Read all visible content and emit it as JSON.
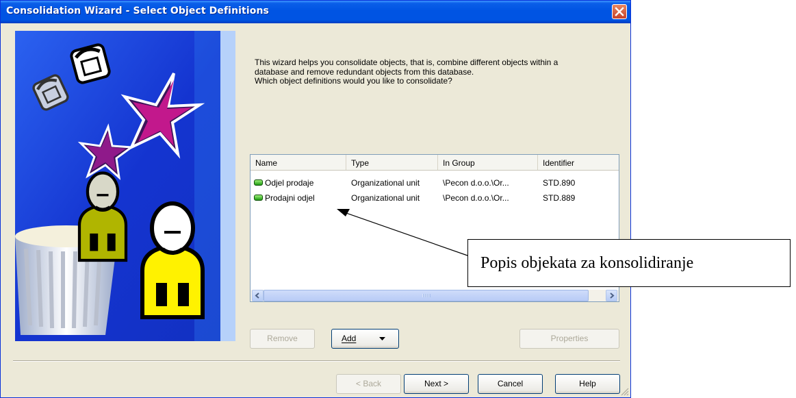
{
  "window": {
    "title": "Consolidation Wizard - Select Object Definitions",
    "close_icon": "close-icon"
  },
  "intro": {
    "line1": "This wizard helps you consolidate objects, that is, combine different objects within a",
    "line2": "database and remove redundant objects from this database.",
    "line3": "Which object definitions would you like to consolidate?"
  },
  "list": {
    "columns": [
      "Name",
      "Type",
      "In Group",
      "Identifier"
    ],
    "rows": [
      {
        "name": "Odjel prodaje",
        "type": "Organizational unit",
        "group": "\\Pecon d.o.o.\\Or...",
        "identifier": "STD.890",
        "icon": "organizational-unit-icon"
      },
      {
        "name": "Prodajni odjel",
        "type": "Organizational unit",
        "group": "\\Pecon d.o.o.\\Or...",
        "identifier": "STD.889",
        "icon": "organizational-unit-icon"
      }
    ]
  },
  "buttons": {
    "remove": "Remove",
    "add": "Add",
    "properties": "Properties",
    "back": "< Back",
    "next": "Next >",
    "cancel": "Cancel",
    "help": "Help"
  },
  "annotation": {
    "text": "Popis objekata za konsolidiranje"
  },
  "colors": {
    "titlebar": "#0054e3",
    "dialog_bg": "#ece9d8",
    "side_panel": "#1d3bd8"
  }
}
